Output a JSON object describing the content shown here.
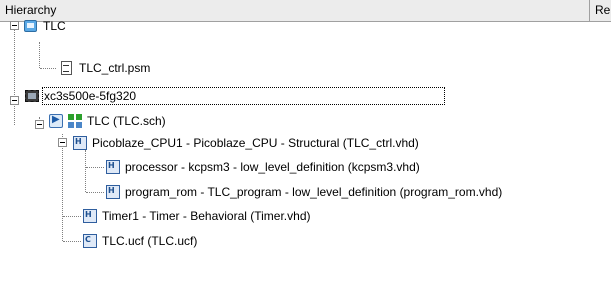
{
  "header": {
    "col_hierarchy": "Hierarchy",
    "col_next": "Re"
  },
  "tree": {
    "tlc_project": "TLC",
    "tlc_ctrl_psm": "TLC_ctrl.psm",
    "device": "xc3s500e-5fg320",
    "tlc_sch": "TLC (TLC.sch)",
    "picoblaze": "Picoblaze_CPU1 - Picoblaze_CPU - Structural (TLC_ctrl.vhd)",
    "processor": "processor - kcpsm3 - low_level_definition (kcpsm3.vhd)",
    "program_rom": "program_rom - TLC_program - low_level_definition (program_rom.vhd)",
    "timer": "Timer1 - Timer - Behavioral (Timer.vhd)",
    "ucf": "TLC.ucf (TLC.ucf)"
  }
}
